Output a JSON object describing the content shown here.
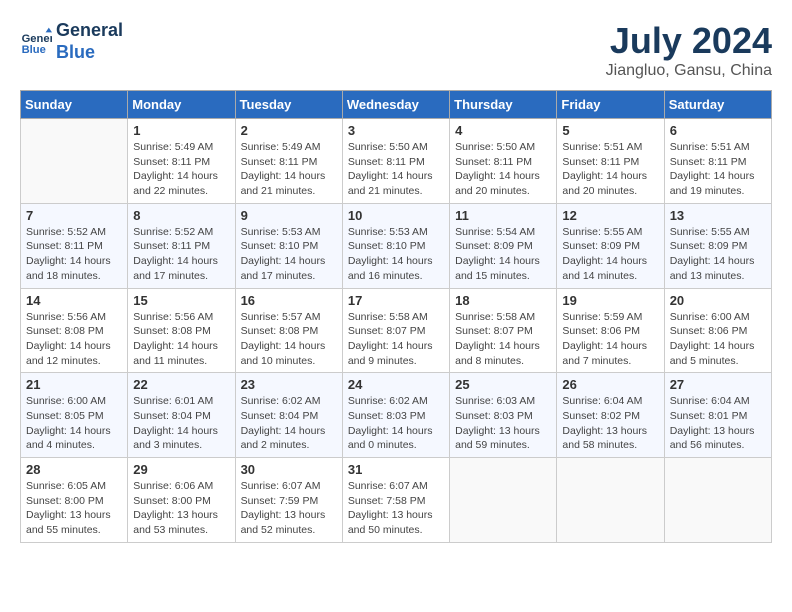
{
  "header": {
    "logo_line1": "General",
    "logo_line2": "Blue",
    "month": "July 2024",
    "location": "Jiangluo, Gansu, China"
  },
  "weekdays": [
    "Sunday",
    "Monday",
    "Tuesday",
    "Wednesday",
    "Thursday",
    "Friday",
    "Saturday"
  ],
  "weeks": [
    [
      {
        "day": "",
        "info": ""
      },
      {
        "day": "1",
        "info": "Sunrise: 5:49 AM\nSunset: 8:11 PM\nDaylight: 14 hours\nand 22 minutes."
      },
      {
        "day": "2",
        "info": "Sunrise: 5:49 AM\nSunset: 8:11 PM\nDaylight: 14 hours\nand 21 minutes."
      },
      {
        "day": "3",
        "info": "Sunrise: 5:50 AM\nSunset: 8:11 PM\nDaylight: 14 hours\nand 21 minutes."
      },
      {
        "day": "4",
        "info": "Sunrise: 5:50 AM\nSunset: 8:11 PM\nDaylight: 14 hours\nand 20 minutes."
      },
      {
        "day": "5",
        "info": "Sunrise: 5:51 AM\nSunset: 8:11 PM\nDaylight: 14 hours\nand 20 minutes."
      },
      {
        "day": "6",
        "info": "Sunrise: 5:51 AM\nSunset: 8:11 PM\nDaylight: 14 hours\nand 19 minutes."
      }
    ],
    [
      {
        "day": "7",
        "info": "Sunrise: 5:52 AM\nSunset: 8:11 PM\nDaylight: 14 hours\nand 18 minutes."
      },
      {
        "day": "8",
        "info": "Sunrise: 5:52 AM\nSunset: 8:11 PM\nDaylight: 14 hours\nand 17 minutes."
      },
      {
        "day": "9",
        "info": "Sunrise: 5:53 AM\nSunset: 8:10 PM\nDaylight: 14 hours\nand 17 minutes."
      },
      {
        "day": "10",
        "info": "Sunrise: 5:53 AM\nSunset: 8:10 PM\nDaylight: 14 hours\nand 16 minutes."
      },
      {
        "day": "11",
        "info": "Sunrise: 5:54 AM\nSunset: 8:09 PM\nDaylight: 14 hours\nand 15 minutes."
      },
      {
        "day": "12",
        "info": "Sunrise: 5:55 AM\nSunset: 8:09 PM\nDaylight: 14 hours\nand 14 minutes."
      },
      {
        "day": "13",
        "info": "Sunrise: 5:55 AM\nSunset: 8:09 PM\nDaylight: 14 hours\nand 13 minutes."
      }
    ],
    [
      {
        "day": "14",
        "info": "Sunrise: 5:56 AM\nSunset: 8:08 PM\nDaylight: 14 hours\nand 12 minutes."
      },
      {
        "day": "15",
        "info": "Sunrise: 5:56 AM\nSunset: 8:08 PM\nDaylight: 14 hours\nand 11 minutes."
      },
      {
        "day": "16",
        "info": "Sunrise: 5:57 AM\nSunset: 8:08 PM\nDaylight: 14 hours\nand 10 minutes."
      },
      {
        "day": "17",
        "info": "Sunrise: 5:58 AM\nSunset: 8:07 PM\nDaylight: 14 hours\nand 9 minutes."
      },
      {
        "day": "18",
        "info": "Sunrise: 5:58 AM\nSunset: 8:07 PM\nDaylight: 14 hours\nand 8 minutes."
      },
      {
        "day": "19",
        "info": "Sunrise: 5:59 AM\nSunset: 8:06 PM\nDaylight: 14 hours\nand 7 minutes."
      },
      {
        "day": "20",
        "info": "Sunrise: 6:00 AM\nSunset: 8:06 PM\nDaylight: 14 hours\nand 5 minutes."
      }
    ],
    [
      {
        "day": "21",
        "info": "Sunrise: 6:00 AM\nSunset: 8:05 PM\nDaylight: 14 hours\nand 4 minutes."
      },
      {
        "day": "22",
        "info": "Sunrise: 6:01 AM\nSunset: 8:04 PM\nDaylight: 14 hours\nand 3 minutes."
      },
      {
        "day": "23",
        "info": "Sunrise: 6:02 AM\nSunset: 8:04 PM\nDaylight: 14 hours\nand 2 minutes."
      },
      {
        "day": "24",
        "info": "Sunrise: 6:02 AM\nSunset: 8:03 PM\nDaylight: 14 hours\nand 0 minutes."
      },
      {
        "day": "25",
        "info": "Sunrise: 6:03 AM\nSunset: 8:03 PM\nDaylight: 13 hours\nand 59 minutes."
      },
      {
        "day": "26",
        "info": "Sunrise: 6:04 AM\nSunset: 8:02 PM\nDaylight: 13 hours\nand 58 minutes."
      },
      {
        "day": "27",
        "info": "Sunrise: 6:04 AM\nSunset: 8:01 PM\nDaylight: 13 hours\nand 56 minutes."
      }
    ],
    [
      {
        "day": "28",
        "info": "Sunrise: 6:05 AM\nSunset: 8:00 PM\nDaylight: 13 hours\nand 55 minutes."
      },
      {
        "day": "29",
        "info": "Sunrise: 6:06 AM\nSunset: 8:00 PM\nDaylight: 13 hours\nand 53 minutes."
      },
      {
        "day": "30",
        "info": "Sunrise: 6:07 AM\nSunset: 7:59 PM\nDaylight: 13 hours\nand 52 minutes."
      },
      {
        "day": "31",
        "info": "Sunrise: 6:07 AM\nSunset: 7:58 PM\nDaylight: 13 hours\nand 50 minutes."
      },
      {
        "day": "",
        "info": ""
      },
      {
        "day": "",
        "info": ""
      },
      {
        "day": "",
        "info": ""
      }
    ]
  ]
}
